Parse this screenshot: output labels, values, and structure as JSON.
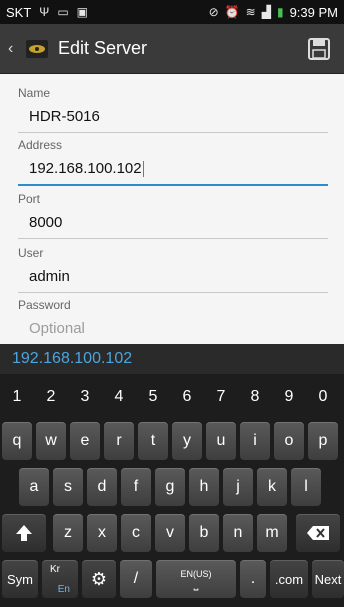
{
  "status": {
    "carrier": "SKT",
    "time": "9:39 PM"
  },
  "actionbar": {
    "title": "Edit Server"
  },
  "form": {
    "fields": [
      {
        "label": "Name",
        "value": "HDR-5016"
      },
      {
        "label": "Address",
        "value": "192.168.100.102"
      },
      {
        "label": "Port",
        "value": "8000"
      },
      {
        "label": "User",
        "value": "admin"
      },
      {
        "label": "Password",
        "placeholder": "Optional"
      }
    ]
  },
  "suggestion": "192.168.100.102",
  "keyboard": {
    "numbers": [
      "1",
      "2",
      "3",
      "4",
      "5",
      "6",
      "7",
      "8",
      "9",
      "0"
    ],
    "row1": [
      "q",
      "w",
      "e",
      "r",
      "t",
      "y",
      "u",
      "i",
      "o",
      "p"
    ],
    "row2": [
      "a",
      "s",
      "d",
      "f",
      "g",
      "h",
      "j",
      "k",
      "l"
    ],
    "row3": [
      "z",
      "x",
      "c",
      "v",
      "b",
      "n",
      "m"
    ],
    "sym": "Sym",
    "lang_top": "Kr",
    "lang_bottom": "En",
    "slash": "/",
    "space_label": "EN(US)",
    "dotcom": ".com",
    "next": "Next"
  }
}
